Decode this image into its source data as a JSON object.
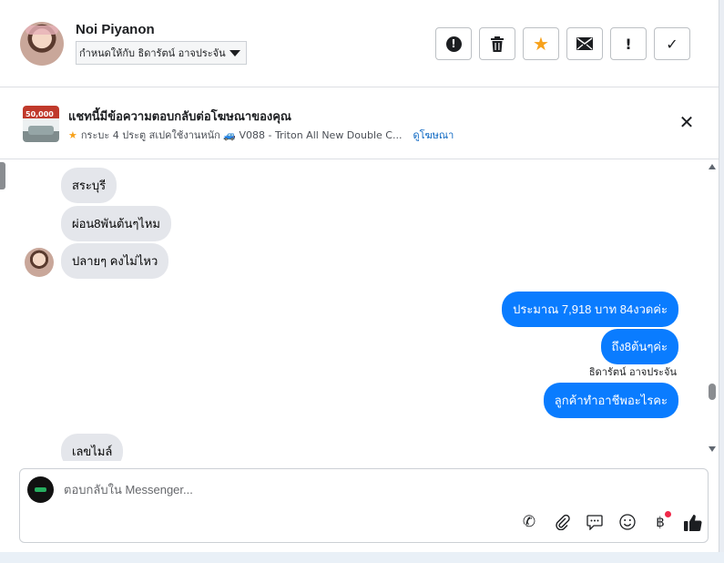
{
  "header": {
    "contact_name": "Noi Piyanon",
    "assign_label": "กำหนดให้กับ ธิดารัตน์ อาจประจัน",
    "tools": [
      {
        "icon": "alert-circle-icon",
        "glyph": "❗"
      },
      {
        "icon": "trash-icon",
        "glyph": "🗑"
      },
      {
        "icon": "star-icon",
        "glyph": "★"
      },
      {
        "icon": "mail-icon",
        "glyph": "✉"
      },
      {
        "icon": "exclamation-icon",
        "glyph": "!"
      },
      {
        "icon": "check-icon",
        "glyph": "✓"
      }
    ]
  },
  "ad": {
    "thumb_text": "50,000",
    "title": "แชทนี้มีข้อความตอบกลับต่อโฆษณาของคุณ",
    "subtitle": "กระบะ 4 ประตู สเปคใช้งานหนัก 🚙 V088 - Triton All New Double C...",
    "link": "ดูโฆษณา",
    "close": "✕"
  },
  "messages": {
    "in": [
      "สระบุรี",
      "ผ่อน8พันต้นๆไหม",
      "ปลายๆ คงไม่ไหว",
      "เลขไมล์"
    ],
    "out": [
      "ประมาณ 7,918 บาท 84งวดค่ะ",
      "ถึง8ต้นๆค่ะ",
      "ลูกค้าทำอาชีพอะไรคะ"
    ],
    "sender_label": "ธิดารัตน์ อาจประจัน"
  },
  "composer": {
    "placeholder": "ตอบกลับใน Messenger...",
    "tools": [
      {
        "icon": "phone-add-icon",
        "glyph": "✆"
      },
      {
        "icon": "attach-icon",
        "glyph": "📎"
      },
      {
        "icon": "saved-replies-icon",
        "glyph": "💬"
      },
      {
        "icon": "emoji-icon",
        "glyph": "☺"
      },
      {
        "icon": "baht-payment-icon",
        "glyph": "฿"
      },
      {
        "icon": "thumbs-up-icon",
        "glyph": "👍"
      }
    ]
  },
  "colors": {
    "outgoing_bubble": "#0a7cff",
    "incoming_bubble": "#e4e6eb",
    "star": "#f7a11a",
    "link": "#0a66c2"
  }
}
